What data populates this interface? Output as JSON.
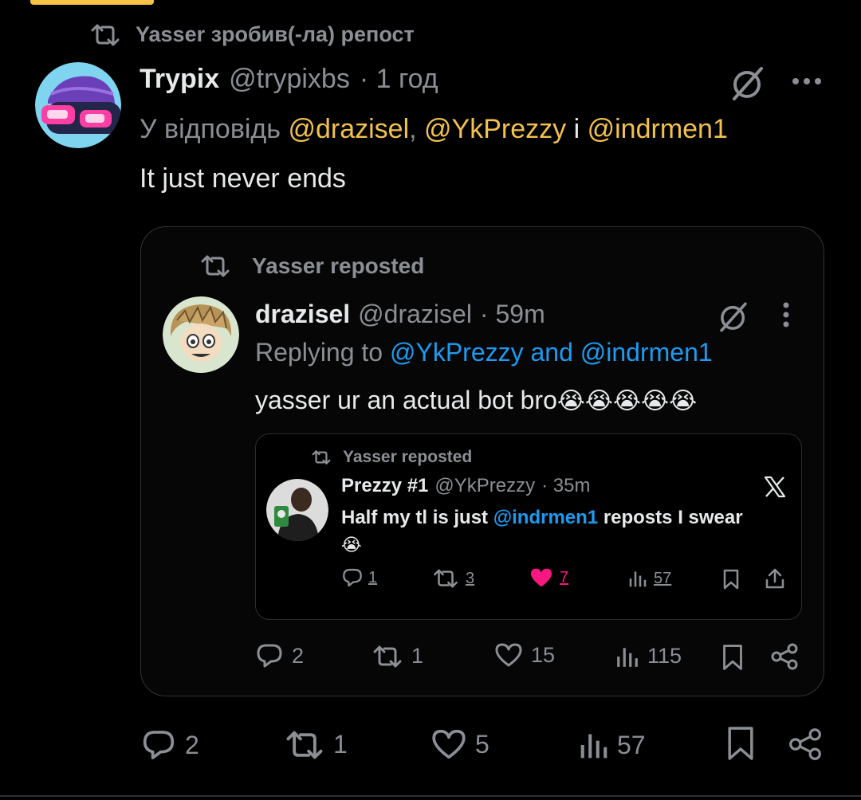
{
  "accent_color": "#f2c14e",
  "link_color": "#1d9bf0",
  "outer": {
    "repost_label": "Yasser зробив(-ла) репост",
    "display_name": "Trypix",
    "handle": "@trypixbs",
    "time": "· 1 год",
    "reply_prefix": "У відповідь",
    "reply_to": [
      "@drazisel",
      "@YkPrezzy",
      "@indrmen1"
    ],
    "reply_sep1": ",",
    "reply_sep2": "і",
    "text": "It just never ends",
    "actions": {
      "replies": "2",
      "reposts": "1",
      "likes": "5",
      "views": "57"
    }
  },
  "quote": {
    "repost_label": "Yasser reposted",
    "display_name": "drazisel",
    "handle": "@drazisel",
    "time": "· 59m",
    "reply_prefix": "Replying to",
    "reply_to": "@YkPrezzy and @indrmen1",
    "text": "yasser ur an actual bot bro",
    "emojis": "😭😭😭😭😭",
    "actions": {
      "replies": "2",
      "reposts": "1",
      "likes": "15",
      "views": "115"
    }
  },
  "nested": {
    "repost_label": "Yasser reposted",
    "display_name": "Prezzy #1",
    "handle": "@YkPrezzy",
    "time": "· 35m",
    "text_before": "Half my tl is just",
    "mention": "@indrmen1",
    "text_after": "reposts I swear",
    "emoji": "😭",
    "platform_icon": "x-logo",
    "actions": {
      "replies": "1",
      "reposts": "3",
      "likes": "7",
      "views": "57"
    }
  }
}
